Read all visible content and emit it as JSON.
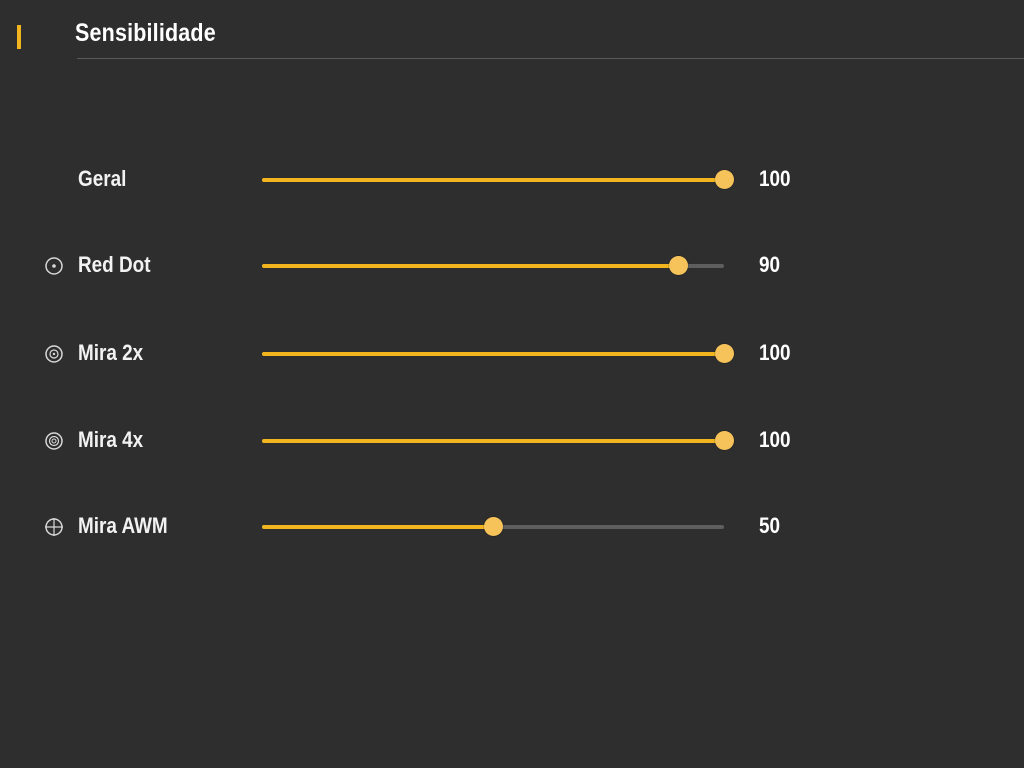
{
  "header": {
    "title": "Sensibilidade",
    "accent_color": "#f2b51d"
  },
  "colors": {
    "background": "#2e2e2e",
    "slider_fill": "#f2b51d",
    "slider_track": "#5e5e5e",
    "slider_thumb": "#f6c35a",
    "text": "#ffffff"
  },
  "sensitivity": {
    "max": 100,
    "items": [
      {
        "label": "Geral",
        "value": "100",
        "level": 100,
        "icon": ""
      },
      {
        "label": "Red Dot",
        "value": "90",
        "level": 90,
        "icon": "red-dot-scope-icon"
      },
      {
        "label": "Mira 2x",
        "value": "100",
        "level": 100,
        "icon": "scope-2x-icon"
      },
      {
        "label": "Mira 4x",
        "value": "100",
        "level": 100,
        "icon": "scope-4x-icon"
      },
      {
        "label": "Mira AWM",
        "value": "50",
        "level": 50,
        "icon": "awm-crosshair-icon"
      }
    ]
  }
}
